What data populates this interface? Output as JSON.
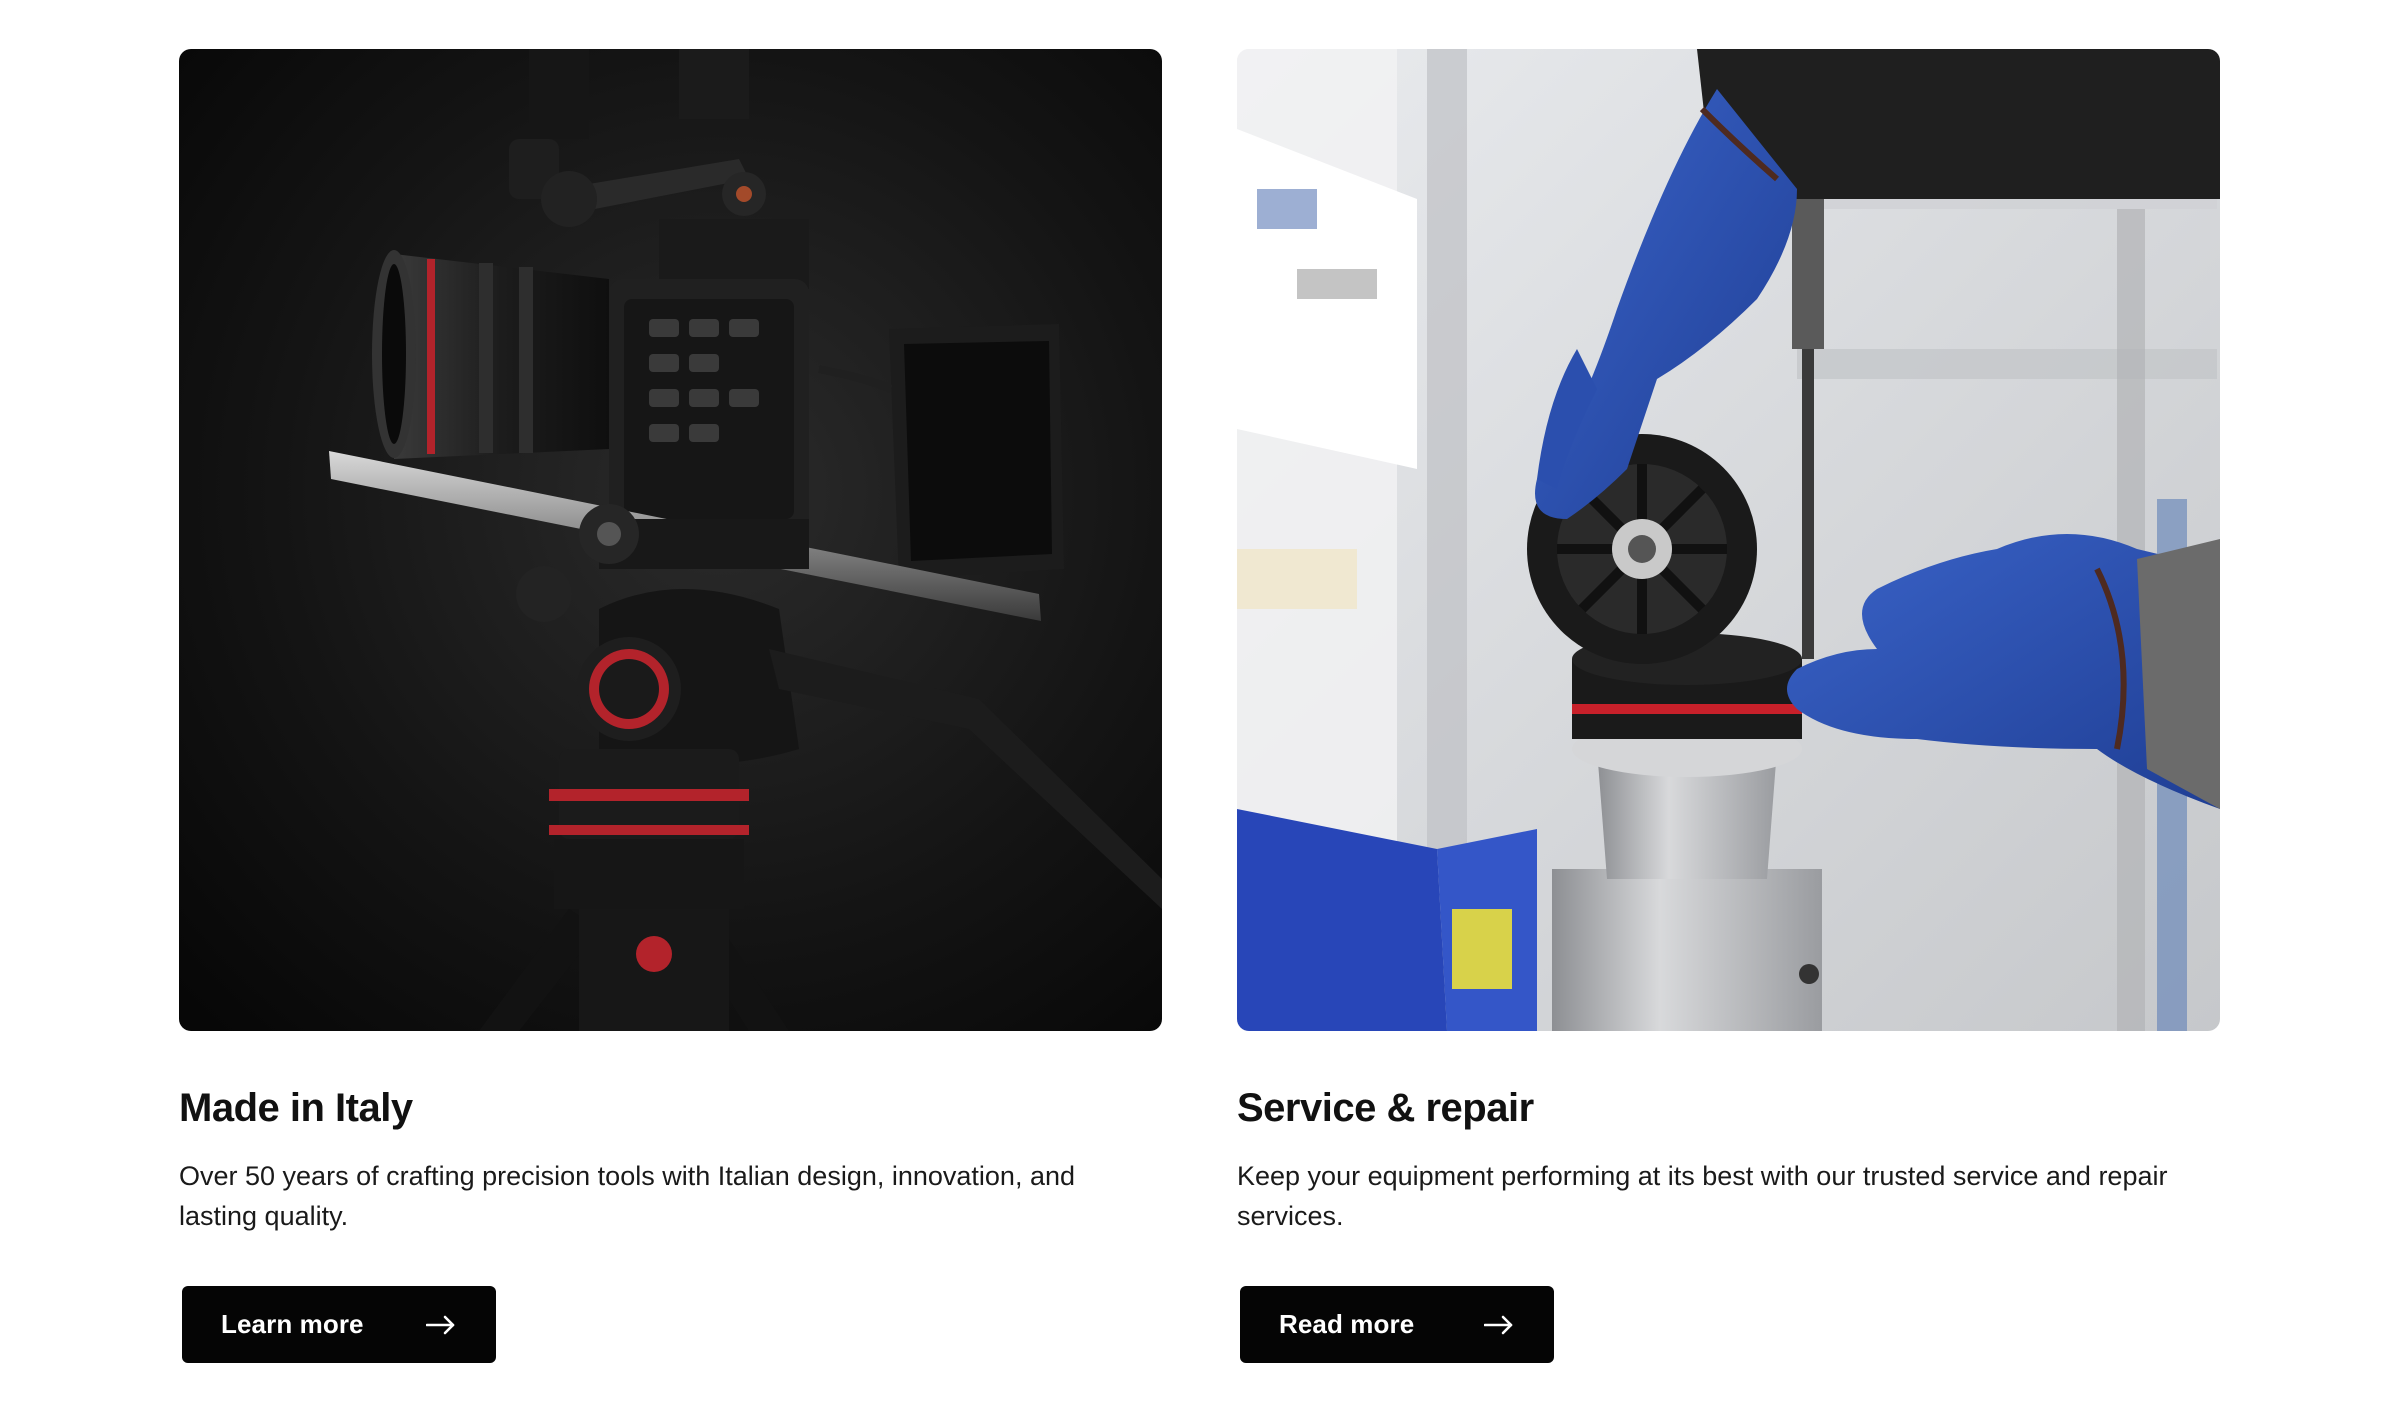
{
  "cards": [
    {
      "image_alt": "Cinema camera rig mounted on a Manfrotto fluid video head and tripod against a black background",
      "title": "Made in Italy",
      "description": "Over 50 years of crafting precision tools with Italian design, innovation, and lasting quality.",
      "button_label": "Learn more",
      "button_icon": "arrow-right-icon"
    },
    {
      "image_alt": "Technician wearing blue gloves assembling a fluid head component in a workshop",
      "title": "Service & repair",
      "description": "Keep your equipment performing at its best with our trusted service and repair services.",
      "button_label": "Read more",
      "button_icon": "arrow-right-icon"
    }
  ],
  "colors": {
    "background": "#ffffff",
    "button_bg": "#050505",
    "button_text": "#ffffff",
    "accent_red": "#c8202a",
    "glove_blue": "#2f55b8"
  }
}
